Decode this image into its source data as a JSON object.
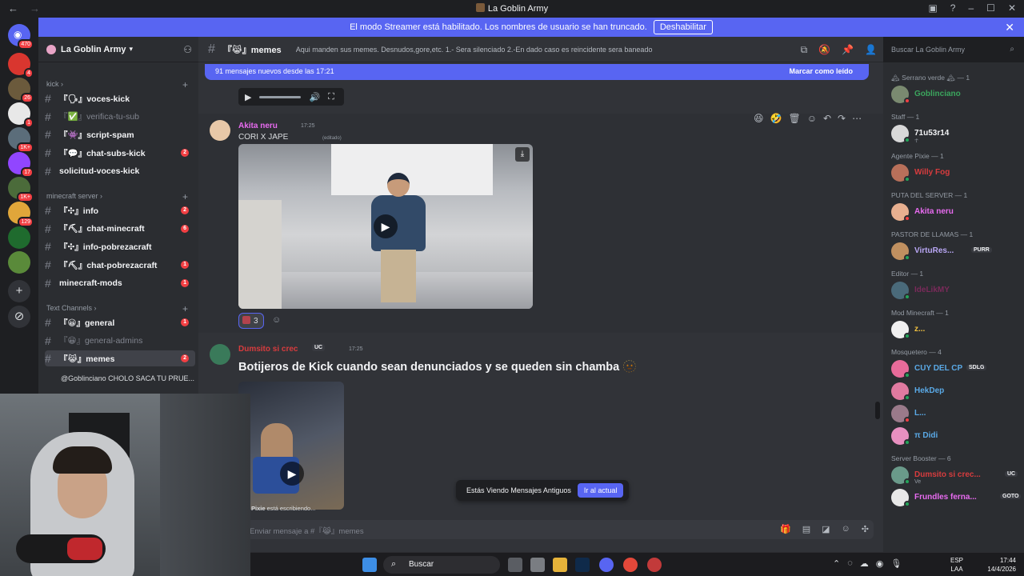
{
  "window": {
    "title": "La Goblin Army"
  },
  "banner": {
    "text": "El modo Streamer está habilitado. Los nombres de usuario se han truncado.",
    "disable_label": "Deshabilitar"
  },
  "rail": {
    "home_badge": "470",
    "servers": [
      {
        "badge": "4",
        "color": "#d9362f"
      },
      {
        "badge": "26",
        "color": "#6b5a3c"
      },
      {
        "badge": "1",
        "color": "#e8e8e8"
      },
      {
        "badge": "1K+",
        "color": "#5b6d7a"
      },
      {
        "badge": "17",
        "color": "#9146ff"
      },
      {
        "badge": "1K+",
        "color": "#4b6b3a"
      },
      {
        "badge": "129",
        "color": "#e0a63a"
      },
      {
        "badge": "",
        "color": "#1f6b2e"
      },
      {
        "badge": "",
        "color": "#5a8a3a"
      }
    ]
  },
  "sidebar": {
    "server_name": "La Goblin Army",
    "categories": [
      {
        "label": "kick",
        "channels": [
          {
            "name": "『🗣』voces-kick",
            "unread": "",
            "muted": false
          },
          {
            "name": "『✅』verifica-tu-sub",
            "unread": "",
            "muted": true
          },
          {
            "name": "『👾』script-spam",
            "unread": "",
            "muted": false
          },
          {
            "name": "『💬』chat-subs-kick",
            "unread": "2",
            "muted": false
          },
          {
            "name": "solicitud-voces-kick",
            "unread": "",
            "muted": false
          }
        ]
      },
      {
        "label": "minecraft server",
        "channels": [
          {
            "name": "『✣』info",
            "unread": "2",
            "muted": false
          },
          {
            "name": "『⛏』chat-minecraft",
            "unread": "6",
            "muted": false
          },
          {
            "name": "『✣』info-pobrezacraft",
            "unread": "",
            "muted": false
          },
          {
            "name": "『⛏』chat-pobrezacraft",
            "unread": "1",
            "muted": false
          },
          {
            "name": "minecraft-mods",
            "unread": "1",
            "muted": false
          }
        ]
      },
      {
        "label": "Text Channels",
        "channels": [
          {
            "name": "『😀』general",
            "unread": "1",
            "muted": false
          },
          {
            "name": "『😀』general-admins",
            "unread": "",
            "muted": true
          },
          {
            "name": "『😹』memes",
            "unread": "2",
            "muted": false,
            "active": true
          }
        ]
      }
    ],
    "thread": "@Goblinciano CHOLO SACA TU PRUE..."
  },
  "channel": {
    "name": "『😹』memes",
    "topic": "Aqui manden sus memes. Desnudos,gore,etc. 1.- Sera silenciado 2.-En dado caso es reincidente sera baneado",
    "search_placeholder": "Buscar La Goblin Army"
  },
  "chat": {
    "new_messages": "91 mensajes nuevos desde las 17:21",
    "mark_read": "Marcar como leído",
    "messages": [
      {
        "author": "Akita neru",
        "time": "17:25",
        "text": "CORI X JAPE",
        "edited": "(editado)",
        "reaction_count": "3",
        "color": "#e86bf0"
      },
      {
        "author": "Dumsito si crec",
        "time": "17:25",
        "text": "Botijeros de Kick cuando sean denunciados y se queden sin chamba 🫥",
        "color": "#d83c3e",
        "tag": "UC"
      }
    ],
    "typing_user": "Pixie",
    "typing_text": " está escribiendo...",
    "old_notice": "Estás Viendo Mensajes Antiguos",
    "jump_label": "Ir al actual",
    "composer_placeholder": "Enviar mensaje a #『😹』memes"
  },
  "members": {
    "groups": [
      {
        "role": "🏔 Serrano verde 🏔 — 1",
        "members": [
          {
            "name": "Goblinciano",
            "color": "#3ba55d",
            "status": "#f23f43"
          }
        ]
      },
      {
        "role": "Staff — 1",
        "members": [
          {
            "name": "71u53r14",
            "color": "#f2f3f5",
            "status": "#23a55a",
            "sub": "☥"
          }
        ]
      },
      {
        "role": "Agente Pixie — 1",
        "members": [
          {
            "name": "Willy Fog",
            "color": "#d83c3e",
            "status": "#23a55a"
          }
        ]
      },
      {
        "role": "PUTA DEL SERVER — 1",
        "members": [
          {
            "name": "Akita neru",
            "color": "#e86bf0",
            "status": "#f23f43"
          }
        ]
      },
      {
        "role": "PASTOR DE LLAMAS — 1",
        "members": [
          {
            "name": "VirtuRes...",
            "color": "#b9a7f5",
            "status": "#23a55a",
            "tag": "PURR"
          }
        ]
      },
      {
        "role": "Editor — 1",
        "members": [
          {
            "name": "IdeLikMY",
            "color": "#7a2a5a",
            "status": "#23a55a"
          }
        ]
      },
      {
        "role": "Mod Minecraft — 1",
        "members": [
          {
            "name": "z...",
            "color": "#f0c040",
            "status": "#23a55a"
          }
        ]
      },
      {
        "role": "Mosquetero — 4",
        "members": [
          {
            "name": "CUY DEL CP",
            "color": "#5aa9e6",
            "status": "#23a55a",
            "tag": "SDLG"
          },
          {
            "name": "HekDep",
            "color": "#5aa9e6",
            "status": "#23a55a"
          },
          {
            "name": "L...",
            "color": "#5aa9e6",
            "status": "#f23f43"
          },
          {
            "name": "π Didi",
            "color": "#5aa9e6",
            "status": "#23a55a"
          }
        ]
      },
      {
        "role": "Server Booster — 6",
        "members": [
          {
            "name": "Dumsito si crec...",
            "color": "#d83c3e",
            "status": "#23a55a",
            "tag": "UC",
            "sub": "Ve"
          },
          {
            "name": "Frundles ferna...",
            "color": "#e86bf0",
            "status": "#23a55a",
            "tag": "GOTO"
          }
        ]
      }
    ]
  },
  "taskbar": {
    "search_label": "Buscar",
    "lang_top": "ESP",
    "lang_bottom": "LAA",
    "time": "17:44",
    "date": "14/4/2026"
  }
}
